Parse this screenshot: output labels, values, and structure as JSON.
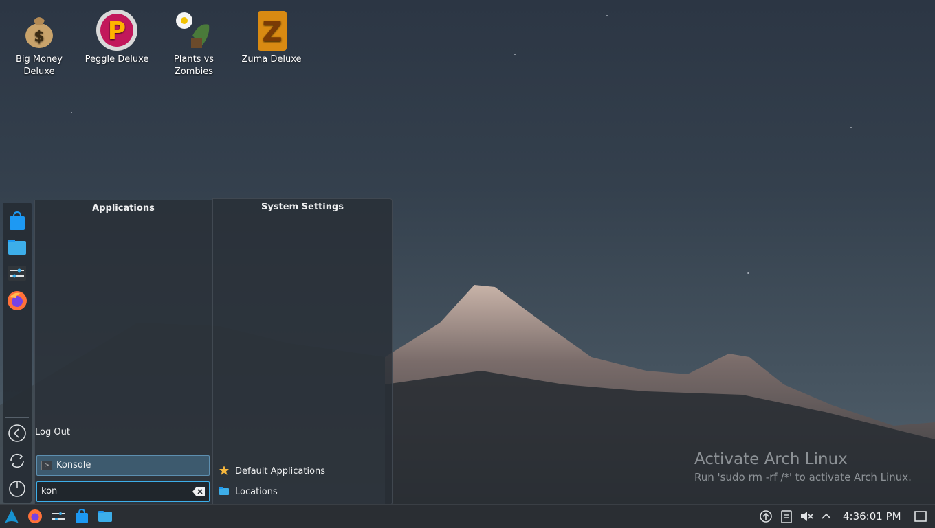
{
  "desktop": {
    "icons": [
      {
        "label": "Big Money Deluxe",
        "icon": "money-bag-icon"
      },
      {
        "label": "Peggle Deluxe",
        "icon": "peggle-icon"
      },
      {
        "label": "Plants vs Zombies",
        "icon": "plants-vs-zombies-icon"
      },
      {
        "label": "Zuma Deluxe",
        "icon": "zuma-icon"
      }
    ],
    "watermark": {
      "title": "Activate Arch Linux",
      "subtitle": "Run 'sudo rm -rf /*' to activate Arch Linux."
    }
  },
  "launcher": {
    "favorites": [
      "discover-store-icon",
      "file-manager-icon",
      "system-settings-icon",
      "firefox-icon"
    ],
    "session": [
      "log-out-icon",
      "restart-icon",
      "shutdown-icon"
    ],
    "applications_title": "Applications",
    "settings_title": "System Settings",
    "logout_label": "Log Out",
    "result": "Konsole",
    "search_value": "kon",
    "settings_results": [
      {
        "label": "Default Applications",
        "icon": "star-icon"
      },
      {
        "label": "Locations",
        "icon": "folder-icon"
      }
    ]
  },
  "taskbar": {
    "left": [
      "arch-launcher-icon",
      "firefox-icon",
      "system-settings-icon",
      "discover-store-icon",
      "file-manager-icon"
    ],
    "tray": [
      "update-icon",
      "clipboard-icon",
      "volume-muted-icon",
      "tray-expand-icon"
    ],
    "clock": "4:36:01 PM"
  }
}
